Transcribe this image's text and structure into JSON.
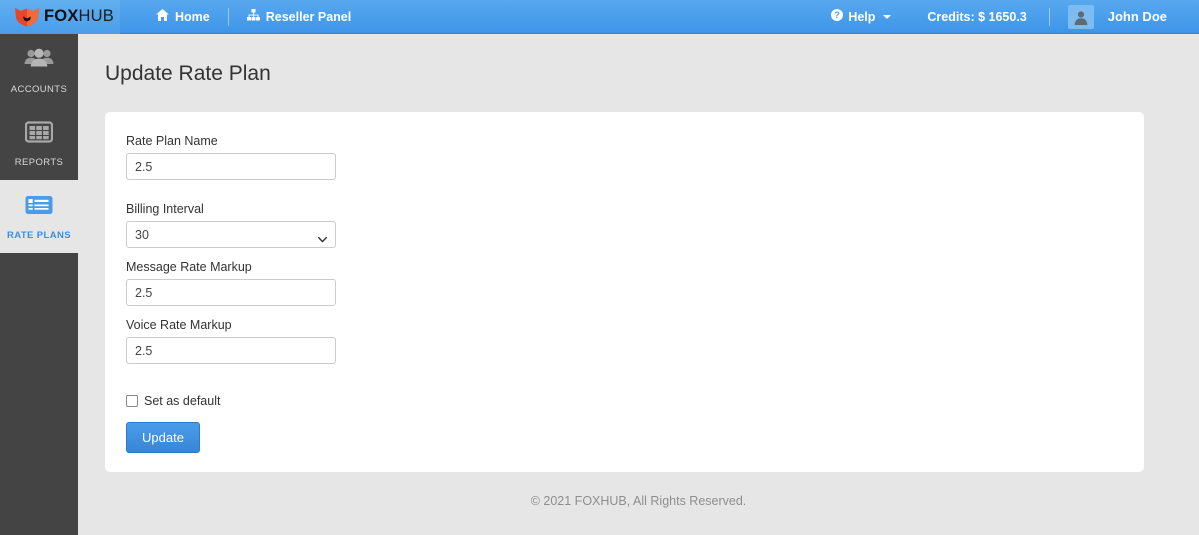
{
  "navbar": {
    "brand": {
      "fox": "FOX",
      "hub": "HUB",
      "logo_icon": "fox-head-icon"
    },
    "links": [
      {
        "label": "Home",
        "icon": "home-icon"
      },
      {
        "label": "Reseller Panel",
        "icon": "sitemap-icon"
      }
    ],
    "help": {
      "label": "Help",
      "icon": "question-circle-icon",
      "caret": "caret-down-icon"
    },
    "credits": {
      "label": "Credits: $ 1650.3"
    },
    "user": {
      "name": "John Doe",
      "avatar_icon": "user-avatar-icon"
    },
    "colors": {
      "bg_start": "#57a8ee",
      "bg_end": "#3e95e8",
      "brand_bg": "#62afef"
    }
  },
  "sidebar": {
    "items": [
      {
        "label": "ACCOUNTS",
        "icon": "users-group-icon",
        "active": false
      },
      {
        "label": "REPORTS",
        "icon": "table-grid-icon",
        "active": false
      },
      {
        "label": "RATE PLANS",
        "icon": "list-alt-icon",
        "active": true
      }
    ],
    "colors": {
      "bg": "#444444",
      "active_bg": "#e6e6e6",
      "active_text": "#3b8fdd"
    }
  },
  "main": {
    "page_title": "Update Rate Plan",
    "form": {
      "rate_plan_name": {
        "label": "Rate Plan Name",
        "value": "2.5",
        "placeholder": ""
      },
      "billing_interval": {
        "label": "Billing Interval",
        "value": "30",
        "options": [
          "30"
        ]
      },
      "message_rate_markup": {
        "label": "Message Rate Markup",
        "value": "2.5",
        "placeholder": ""
      },
      "voice_rate_markup": {
        "label": "Voice Rate Markup",
        "value": "2.5",
        "placeholder": ""
      },
      "set_as_default": {
        "label": "Set as default",
        "checked": false
      },
      "submit": {
        "label": "Update"
      }
    }
  },
  "footer": {
    "text": "© 2021 FOXHUB, All Rights Reserved."
  }
}
